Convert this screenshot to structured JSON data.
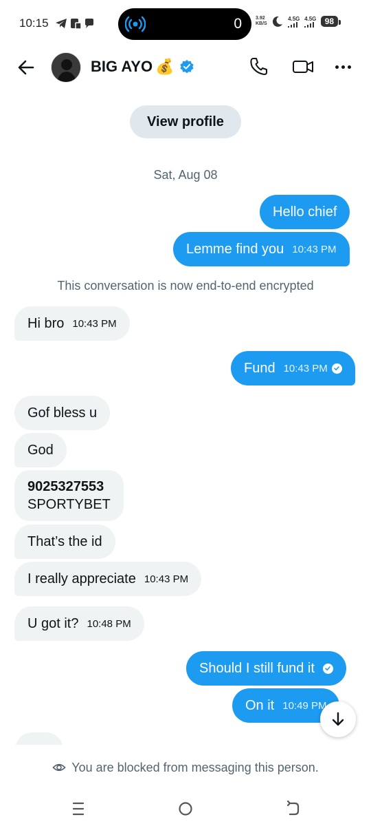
{
  "status_bar": {
    "time": "10:15",
    "pill_count": "0",
    "net_speed": [
      "3.92",
      "KB/S"
    ],
    "net1": "4.5G",
    "net2": "4.5G",
    "battery": "98"
  },
  "header": {
    "contact_name": "BIG AYO",
    "name_emoji": "💰",
    "back_icon": "arrow-left-icon",
    "call_icon": "phone-icon",
    "video_icon": "video-icon",
    "more_icon": "more-horizontal-icon"
  },
  "view_profile_label": "View profile",
  "date_label": "Sat, Aug 08",
  "encrypted_note": "This conversation is now end-to-end encrypted",
  "messages": [
    {
      "dir": "out",
      "text": "Hello chief",
      "time": ""
    },
    {
      "dir": "out",
      "text": "Lemme find you",
      "time": "10:43 PM"
    },
    {
      "dir": "in",
      "text": "Hi bro",
      "time": "10:43 PM"
    },
    {
      "dir": "out",
      "text": "Fund",
      "time": "10:43 PM",
      "seen": true
    },
    {
      "dir": "in",
      "text": "Gof bless u",
      "time": ""
    },
    {
      "dir": "in",
      "text": "God",
      "time": ""
    },
    {
      "dir": "in",
      "line1": "9025327553",
      "line2": "SPORTYBET",
      "time": ""
    },
    {
      "dir": "in",
      "text": "That’s the id",
      "time": ""
    },
    {
      "dir": "in",
      "text": "I really appreciate",
      "time": "10:43 PM"
    },
    {
      "dir": "in",
      "text": "U got it?",
      "time": "10:48 PM"
    },
    {
      "dir": "out",
      "text": "Should I still fund it",
      "time": "",
      "seen": true
    },
    {
      "dir": "out",
      "text": "On it",
      "time": "10:49 PM"
    }
  ],
  "blocked_notice": "You are blocked from messaging this person.",
  "colors": {
    "accent": "#1d9bf0",
    "incoming_bg": "#eff3f4",
    "muted_text": "#536471"
  }
}
